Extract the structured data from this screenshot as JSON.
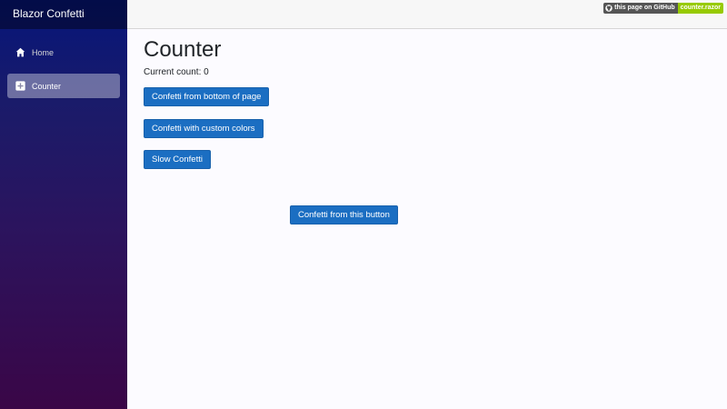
{
  "sidebar": {
    "brand": "Blazor Confetti",
    "items": [
      {
        "label": "Home",
        "icon": "home-icon"
      },
      {
        "label": "Counter",
        "icon": "plus-square-icon",
        "active": true
      }
    ]
  },
  "topbar": {
    "badge_left": "this page on GitHub",
    "badge_right": "counter.razor"
  },
  "main": {
    "title": "Counter",
    "count_text": "Current count: 0",
    "buttons": {
      "bottom": "Confetti from bottom of page",
      "custom": "Confetti with custom colors",
      "slow": "Slow Confetti",
      "this_button": "Confetti from this button"
    }
  },
  "colors": {
    "button_bg": "#1b6ec2",
    "badge_green": "#97ca00",
    "badge_gray": "#555555"
  }
}
